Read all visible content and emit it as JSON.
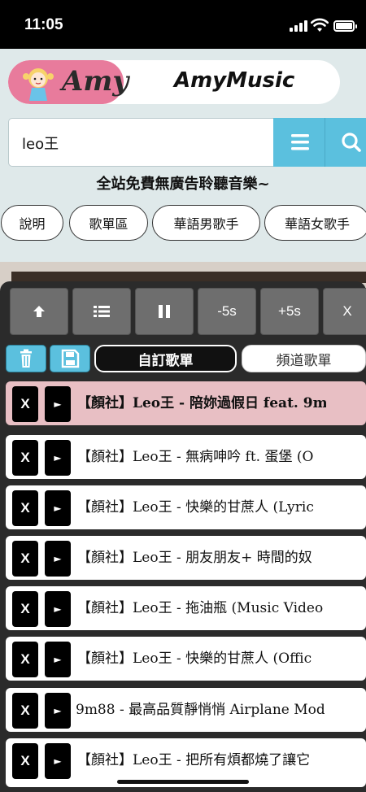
{
  "status_bar": {
    "time": "11:05"
  },
  "header": {
    "logo_text": "Amy",
    "site_title": "AmyMusic"
  },
  "search": {
    "value": "leo王",
    "placeholder": ""
  },
  "slogan": "全站免費無廣告聆聽音樂~",
  "categories": [
    "說明",
    "歌單區",
    "華語男歌手",
    "華語女歌手"
  ],
  "controls": {
    "up_icon": "arrow-up-icon",
    "list_icon": "list-icon",
    "pause_icon": "pause-icon",
    "rewind_label": "-5s",
    "forward_label": "+5s",
    "close_label": "X"
  },
  "tabs": {
    "custom_playlist": "自訂歌單",
    "channel_playlist": "頻道歌單"
  },
  "row_buttons": {
    "remove": "X",
    "play": "►"
  },
  "playlist": [
    "【顏社】Leo王 - 陪妳過假日 feat. 9m",
    "【顏社】Leo王 - 無病呻吟 ft. 蛋堡 (O",
    "【顏社】Leo王 - 快樂的甘蔗人 (Lyric",
    "【顏社】Leo王 - 朋友朋友+ 時間的奴",
    "【顏社】Leo王 - 拖油瓶 (Music Video",
    "【顏社】Leo王 - 快樂的甘蔗人 (Offic",
    "9m88 - 最高品質靜悄悄 Airplane Mod",
    "【顏社】Leo王 - 把所有煩都燒了讓它"
  ],
  "colors": {
    "accent": "#5bc0de",
    "active_row": "#e8bfc4",
    "panel": "#2b2b2b",
    "background": "#dfe9ea"
  }
}
